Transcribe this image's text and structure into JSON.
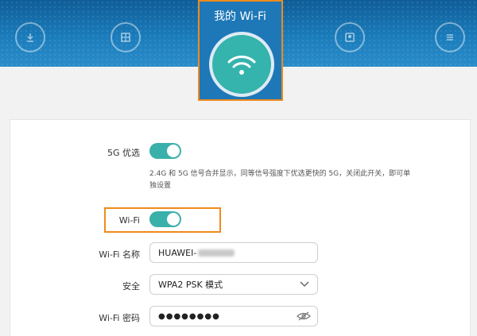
{
  "nav": [
    {
      "label": "",
      "icon": "download-icon"
    },
    {
      "label": "",
      "icon": "globe-icon"
    },
    {
      "label": "",
      "icon": "devices-icon"
    },
    {
      "label": "",
      "icon": "menu-icon"
    }
  ],
  "header": {
    "title": "我的 Wi-Fi"
  },
  "form": {
    "band_steering": {
      "label": "5G 优选",
      "on": true,
      "hint": "2.4G 和 5G 信号合并显示，同等信号强度下优选更快的 5G，关闭此开关，即可单独设置"
    },
    "wifi": {
      "label": "Wi-Fi",
      "on": true
    },
    "ssid": {
      "label": "Wi-Fi 名称",
      "value": "HUAWEI-"
    },
    "security": {
      "label": "安全",
      "value": "WPA2 PSK 模式"
    },
    "password": {
      "label": "Wi-Fi 密码",
      "value": "●●●●●●●●"
    }
  },
  "colors": {
    "accent": "#39b0aa",
    "highlight": "#f08a1c",
    "header": "#1b7cbb"
  }
}
